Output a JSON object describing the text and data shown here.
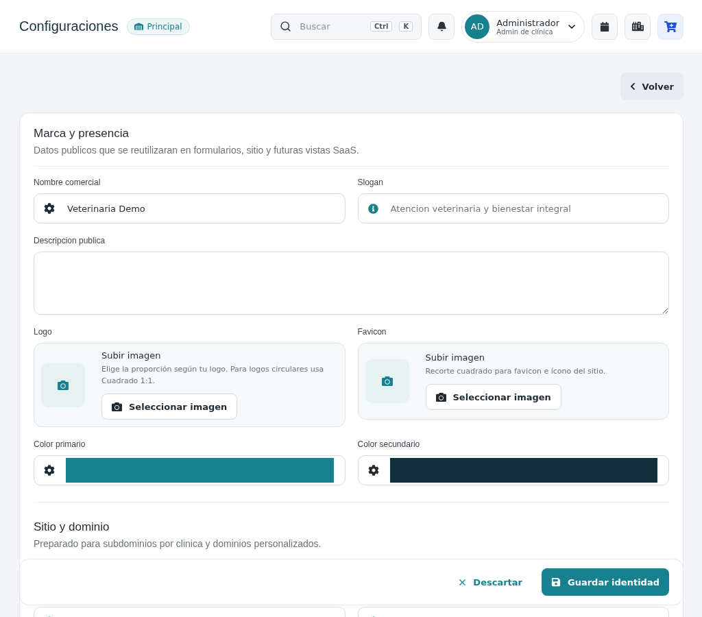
{
  "header": {
    "title": "Configuraciones",
    "badge": "Principal",
    "search": {
      "placeholder": "Buscar",
      "keys": [
        "Ctrl",
        "K"
      ]
    },
    "user": {
      "initials": "AD",
      "name": "Administrador",
      "role": "Admin de clínica"
    }
  },
  "back_button": "Volver",
  "brand": {
    "title": "Marca y presencia",
    "subtitle": "Datos publicos que se reutilizaran en formularios, sitio y futuras vistas SaaS.",
    "fields": [
      {
        "label": "Nombre comercial",
        "value": "Veterinaria Demo"
      },
      {
        "label": "Slogan",
        "placeholder": "Atencion veterinaria y bienestar integral"
      }
    ],
    "description": {
      "label": "Descripcion publica"
    },
    "uploads": [
      {
        "label": "Logo",
        "title": "Subir imagen",
        "hint": "Elige la proporción según tu logo. Para logos circulares usa Cuadrado 1:1.",
        "button": "Seleccionar imagen"
      },
      {
        "label": "Favicon",
        "title": "Subir imagen",
        "hint": "Recorte cuadrado para favicon e ícono del sitio.",
        "button": "Seleccionar imagen"
      }
    ],
    "colors": [
      {
        "label": "Color primario",
        "color": "#17818f"
      },
      {
        "label": "Color secundario",
        "color": "#112e3c"
      }
    ]
  },
  "site": {
    "title": "Sitio y dominio",
    "subtitle": "Preparado para subdominios por clinica y dominios personalizados."
  },
  "actions": {
    "discard": "Descartar",
    "save": "Guardar identidad"
  }
}
